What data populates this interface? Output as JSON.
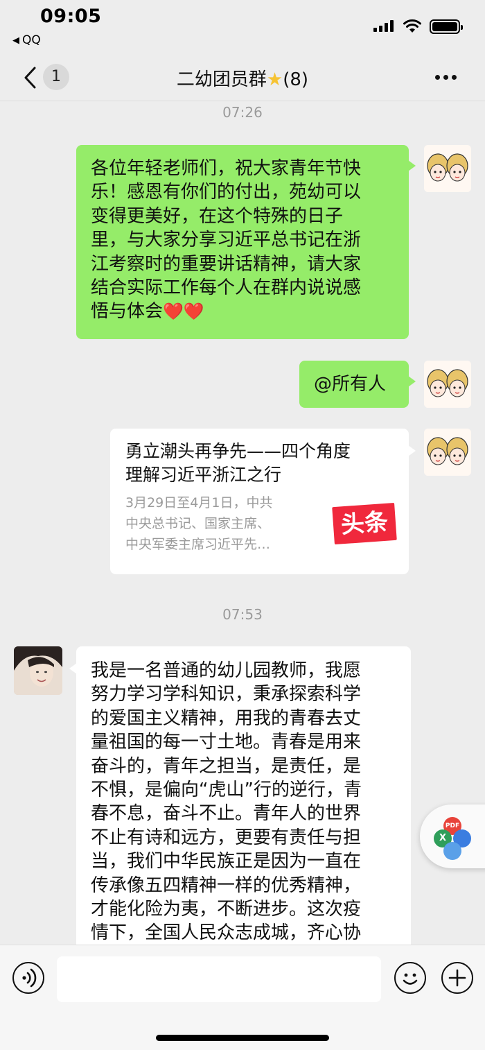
{
  "status_bar": {
    "time": "09:05",
    "back_app_label": "QQ"
  },
  "nav": {
    "unread_count": "1",
    "title": "二幼团员群",
    "title_icon": "glowing-star-icon",
    "member_count": "(8)"
  },
  "chat": {
    "timestamps": [
      "07:26",
      "07:53"
    ],
    "messages": [
      {
        "side": "right",
        "type": "text",
        "lines": [
          "各位年轻老师们，祝大家青年节快",
          "乐！感恩有你们的付出，苑幼可以",
          "变得更美好，在这个特殊的日子",
          "里，与大家分享习近平总书记在浙",
          "江考察时的重要讲话精神，请大家",
          "结合实际工作每个人在群内说说感",
          "悟与体会"
        ],
        "trailing_emoji": "❤️❤️"
      },
      {
        "side": "right",
        "type": "text",
        "text": "@所有人"
      },
      {
        "side": "right",
        "type": "link-card",
        "title_lines": [
          "勇立潮头再争先——四个角度",
          "理解习近平浙江之行"
        ],
        "description_lines": [
          "3月29日至4月1日，中共",
          "中央总书记、国家主席、",
          "中央军委主席习近平先…"
        ],
        "source_logo_text": "头条"
      },
      {
        "side": "left",
        "type": "text",
        "lines": [
          "我是一名普通的幼儿园教师，我愿",
          "努力学习学科知识，秉承探索科学",
          "的爱国主义精神，用我的青春去丈",
          "量祖国的每一寸土地。青春是用来",
          "奋斗的，青年之担当，是责任，是",
          "不惧，是偏向“虎山”行的逆行，青",
          "春不息，奋斗不止。青年人的世界",
          "不止有诗和远方，更要有责任与担",
          "当，我们中华民族正是因为一直在",
          "传承像五四精神一样的优秀精神，",
          "才能化险为夷，不断进步。这次疫",
          "情下，全国人民众志成城，齐心协"
        ]
      }
    ]
  },
  "floating_widget": {
    "pdf_label": "PDF",
    "excel_label": "X",
    "colors": [
      "#e8433a",
      "#2f9e5a",
      "#3b7de0"
    ]
  },
  "input_bar": {
    "value": "",
    "placeholder": ""
  },
  "colors": {
    "background": "#ededed",
    "sent_bubble": "#95ec69",
    "received_bubble": "#ffffff",
    "toutiao_red": "#f0283c"
  }
}
